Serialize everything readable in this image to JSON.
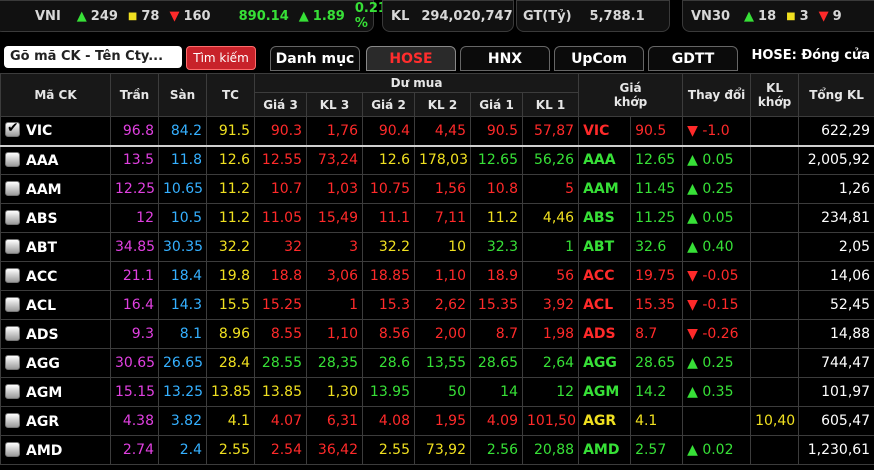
{
  "ticker": {
    "vni_label": "VNI",
    "vni_up": "249",
    "vni_ref": "78",
    "vni_down": "160",
    "vni_index": "890.14",
    "vni_change": "1.89",
    "vni_pct": "0.21 %",
    "kl_label": "KL",
    "kl_value": "294,020,747",
    "gt_label": "GT(Tỷ)",
    "gt_value": "5,788.1",
    "vn30_label": "VN30",
    "vn30_up": "18",
    "vn30_ref": "3",
    "vn30_down": "9"
  },
  "search": {
    "placeholder": "Gõ mã CK - Tên Cty...",
    "button": "Tìm kiếm"
  },
  "tabs": [
    "Danh mục",
    "HOSE",
    "HNX",
    "UpCom",
    "GDTT"
  ],
  "status": "HOSE:  Đóng cửa",
  "headers": {
    "symbol": "Mã CK",
    "ceil": "Trần",
    "floor": "Sàn",
    "ref": "TC",
    "bid_group": "Dư mua",
    "g3": "Giá 3",
    "kl3": "KL 3",
    "g2": "Giá 2",
    "kl2": "KL 2",
    "g1": "Giá 1",
    "kl1": "KL 1",
    "match_price": "Giá\nkhớp",
    "change": "Thay đổi",
    "match_vol": "KL\nkhớp",
    "total": "Tổng KL"
  },
  "colors": {
    "ceiling": "#e040e0",
    "floor": "#35b0ff",
    "reference": "#f0e020",
    "up": "#37e037",
    "down": "#ff2a2a"
  },
  "rows": [
    {
      "sym": "VIC",
      "checked": true,
      "ceil": "96.8",
      "floor": "84.2",
      "ref": "91.5",
      "g3": "90.3",
      "kl3": "1,76",
      "g2": "90.4",
      "kl2": "4,45",
      "g1": "90.5",
      "kl1": "57,87",
      "mp": "90.5",
      "chg": "-1.0",
      "dir": "down",
      "mv": "",
      "total": "622,29",
      "c3": "down",
      "c2": "down",
      "c1": "down",
      "cm": "down"
    },
    {
      "sym": "AAA",
      "checked": false,
      "ceil": "13.5",
      "floor": "11.8",
      "ref": "12.6",
      "g3": "12.55",
      "kl3": "73,24",
      "g2": "12.6",
      "kl2": "178,03",
      "g1": "12.65",
      "kl1": "56,26",
      "mp": "12.65",
      "chg": "0.05",
      "dir": "up",
      "mv": "",
      "total": "2,005,92",
      "c3": "down",
      "c2": "ref",
      "c1": "up",
      "cm": "up"
    },
    {
      "sym": "AAM",
      "checked": false,
      "ceil": "12.25",
      "floor": "10.65",
      "ref": "11.2",
      "g3": "10.7",
      "kl3": "1,03",
      "g2": "10.75",
      "kl2": "1,56",
      "g1": "10.8",
      "kl1": "5",
      "mp": "11.45",
      "chg": "0.25",
      "dir": "up",
      "mv": "",
      "total": "1,26",
      "c3": "down",
      "c2": "down",
      "c1": "down",
      "cm": "up"
    },
    {
      "sym": "ABS",
      "checked": false,
      "ceil": "12",
      "floor": "10.5",
      "ref": "11.2",
      "g3": "11.05",
      "kl3": "15,49",
      "g2": "11.1",
      "kl2": "7,11",
      "g1": "11.2",
      "kl1": "4,46",
      "mp": "11.25",
      "chg": "0.05",
      "dir": "up",
      "mv": "",
      "total": "234,81",
      "c3": "down",
      "c2": "down",
      "c1": "ref",
      "cm": "up"
    },
    {
      "sym": "ABT",
      "checked": false,
      "ceil": "34.85",
      "floor": "30.35",
      "ref": "32.2",
      "g3": "32",
      "kl3": "3",
      "g2": "32.2",
      "kl2": "10",
      "g1": "32.3",
      "kl1": "1",
      "mp": "32.6",
      "chg": "0.40",
      "dir": "up",
      "mv": "",
      "total": "2,05",
      "c3": "down",
      "c2": "ref",
      "c1": "up",
      "cm": "up"
    },
    {
      "sym": "ACC",
      "checked": false,
      "ceil": "21.1",
      "floor": "18.4",
      "ref": "19.8",
      "g3": "18.8",
      "kl3": "3,06",
      "g2": "18.85",
      "kl2": "1,10",
      "g1": "18.9",
      "kl1": "56",
      "mp": "19.75",
      "chg": "-0.05",
      "dir": "down",
      "mv": "",
      "total": "14,06",
      "c3": "down",
      "c2": "down",
      "c1": "down",
      "cm": "down"
    },
    {
      "sym": "ACL",
      "checked": false,
      "ceil": "16.4",
      "floor": "14.3",
      "ref": "15.5",
      "g3": "15.25",
      "kl3": "1",
      "g2": "15.3",
      "kl2": "2,62",
      "g1": "15.35",
      "kl1": "3,92",
      "mp": "15.35",
      "chg": "-0.15",
      "dir": "down",
      "mv": "",
      "total": "52,45",
      "c3": "down",
      "c2": "down",
      "c1": "down",
      "cm": "down"
    },
    {
      "sym": "ADS",
      "checked": false,
      "ceil": "9.3",
      "floor": "8.1",
      "ref": "8.96",
      "g3": "8.55",
      "kl3": "1,10",
      "g2": "8.56",
      "kl2": "2,00",
      "g1": "8.7",
      "kl1": "1,98",
      "mp": "8.7",
      "chg": "-0.26",
      "dir": "down",
      "mv": "",
      "total": "14,88",
      "c3": "down",
      "c2": "down",
      "c1": "down",
      "cm": "down"
    },
    {
      "sym": "AGG",
      "checked": false,
      "ceil": "30.65",
      "floor": "26.65",
      "ref": "28.4",
      "g3": "28.55",
      "kl3": "28,35",
      "g2": "28.6",
      "kl2": "13,55",
      "g1": "28.65",
      "kl1": "2,64",
      "mp": "28.65",
      "chg": "0.25",
      "dir": "up",
      "mv": "",
      "total": "744,47",
      "c3": "up",
      "c2": "up",
      "c1": "up",
      "cm": "up"
    },
    {
      "sym": "AGM",
      "checked": false,
      "ceil": "15.15",
      "floor": "13.25",
      "ref": "13.85",
      "g3": "13.85",
      "kl3": "1,30",
      "g2": "13.95",
      "kl2": "50",
      "g1": "14",
      "kl1": "12",
      "mp": "14.2",
      "chg": "0.35",
      "dir": "up",
      "mv": "",
      "total": "101,97",
      "c3": "ref",
      "c2": "up",
      "c1": "up",
      "cm": "up"
    },
    {
      "sym": "AGR",
      "checked": false,
      "ceil": "4.38",
      "floor": "3.82",
      "ref": "4.1",
      "g3": "4.07",
      "kl3": "6,31",
      "g2": "4.08",
      "kl2": "1,95",
      "g1": "4.09",
      "kl1": "101,50",
      "mp": "4.1",
      "chg": "",
      "dir": "ref",
      "mv": "10,40",
      "total": "605,47",
      "c3": "down",
      "c2": "down",
      "c1": "down",
      "cm": "ref"
    },
    {
      "sym": "AMD",
      "checked": false,
      "ceil": "2.74",
      "floor": "2.4",
      "ref": "2.55",
      "g3": "2.54",
      "kl3": "36,42",
      "g2": "2.55",
      "kl2": "73,92",
      "g1": "2.56",
      "kl1": "20,88",
      "mp": "2.57",
      "chg": "0.02",
      "dir": "up",
      "mv": "",
      "total": "1,230,61",
      "c3": "down",
      "c2": "ref",
      "c1": "up",
      "cm": "up"
    }
  ]
}
